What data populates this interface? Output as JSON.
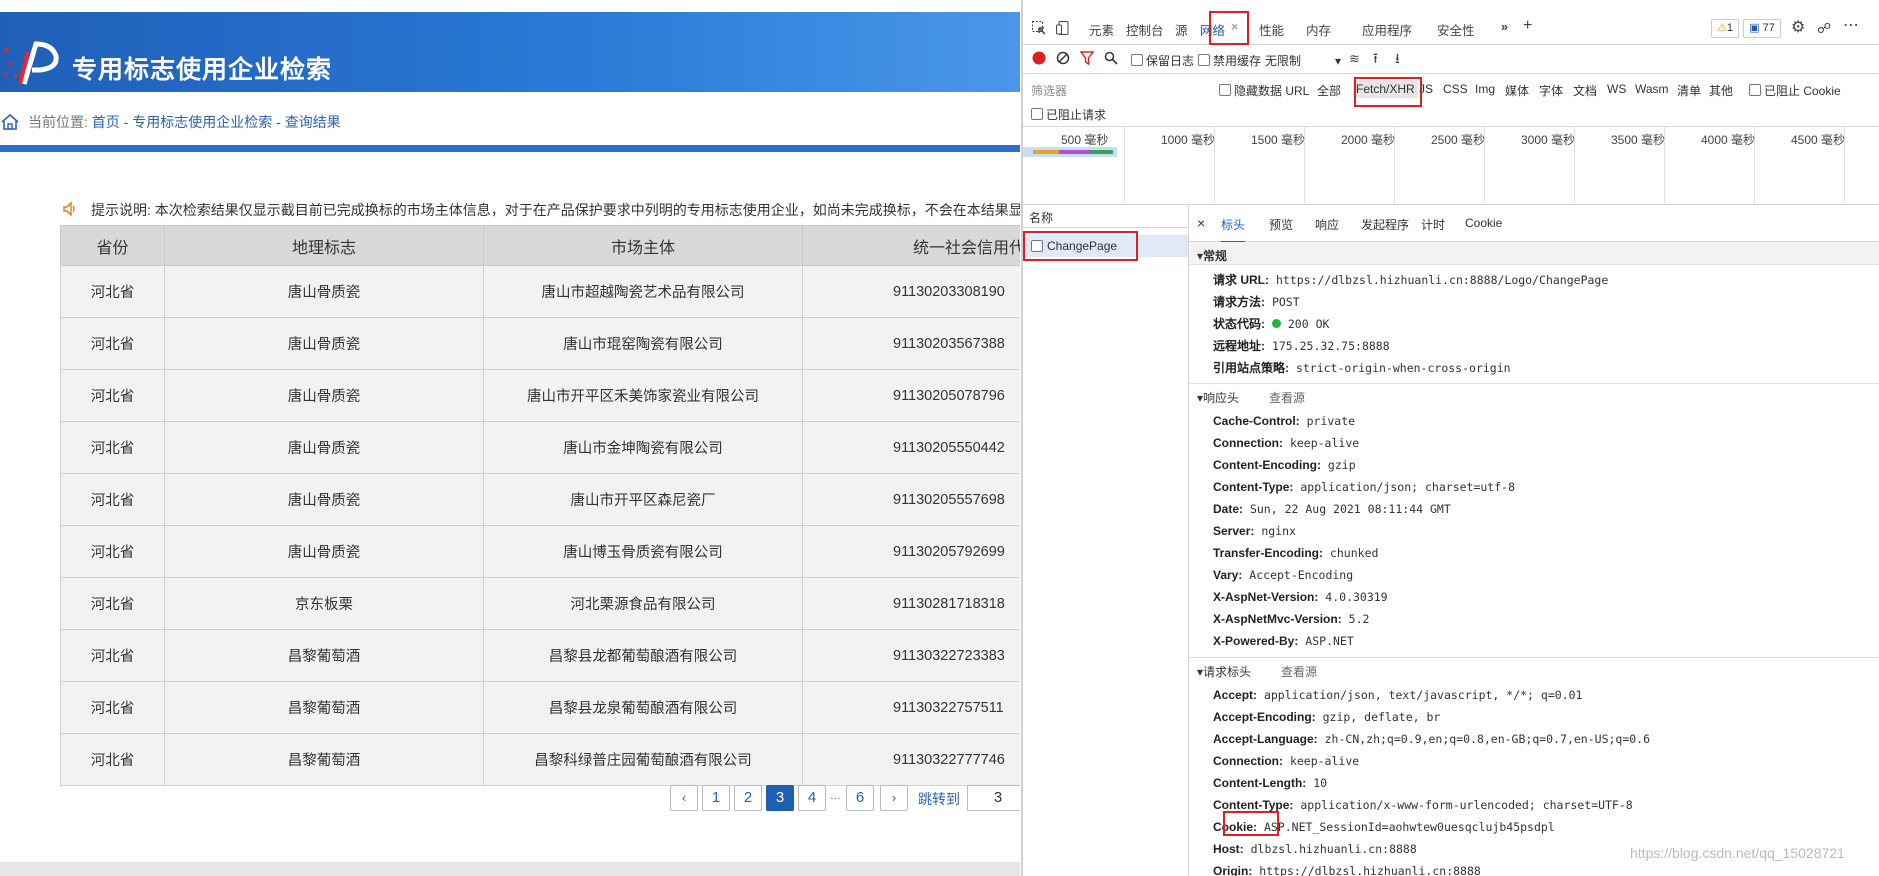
{
  "site": {
    "title": "专用标志使用企业检索",
    "breadcrumb": {
      "prefix": "当前位置:",
      "home": "首页",
      "sep1": "-",
      "section": "专用标志使用企业检索",
      "sep2": "-",
      "current": "查询结果"
    },
    "notice": "提示说明: 本次检索结果仅显示截目前已完成换标的市场主体信息，对于在产品保护要求中列明的专用标志使用企业，如尚未完成换标，不会在本结果显"
  },
  "table": {
    "headers": [
      "省份",
      "地理标志",
      "市场主体",
      "统一社会信用代"
    ],
    "rows": [
      [
        "河北省",
        "唐山骨质瓷",
        "唐山市超越陶瓷艺术品有限公司",
        "91130203308190"
      ],
      [
        "河北省",
        "唐山骨质瓷",
        "唐山市琨窑陶瓷有限公司",
        "91130203567388"
      ],
      [
        "河北省",
        "唐山骨质瓷",
        "唐山市开平区禾美饰家瓷业有限公司",
        "91130205078796"
      ],
      [
        "河北省",
        "唐山骨质瓷",
        "唐山市金坤陶瓷有限公司",
        "91130205550442"
      ],
      [
        "河北省",
        "唐山骨质瓷",
        "唐山市开平区森尼瓷厂",
        "91130205557698"
      ],
      [
        "河北省",
        "唐山骨质瓷",
        "唐山博玉骨质瓷有限公司",
        "91130205792699"
      ],
      [
        "河北省",
        "京东板栗",
        "河北栗源食品有限公司",
        "91130281718318"
      ],
      [
        "河北省",
        "昌黎葡萄酒",
        "昌黎县龙都葡萄酿酒有限公司",
        "91130322723383"
      ],
      [
        "河北省",
        "昌黎葡萄酒",
        "昌黎县龙泉葡萄酿酒有限公司",
        "91130322757511"
      ],
      [
        "河北省",
        "昌黎葡萄酒",
        "昌黎科绿普庄园葡萄酿酒有限公司",
        "91130322777746"
      ]
    ]
  },
  "pager": {
    "prev": "‹",
    "next": "›",
    "pages": [
      "1",
      "2",
      "3",
      "4",
      "6"
    ],
    "current": "3",
    "dots": "...",
    "jump_label": "跳转到",
    "jump_value": "3"
  },
  "devtools": {
    "tabs": [
      "元素",
      "控制台",
      "源",
      "网络",
      "性能",
      "内存",
      "应用程序",
      "安全性"
    ],
    "active_tab": "网络",
    "warn_count": "1",
    "msg_count": "77",
    "toolbar": {
      "preserve_log": "保留日志",
      "disable_cache": "禁用缓存",
      "throttle": "无限制"
    },
    "filter": {
      "placeholder": "筛选器",
      "hide_data_url": "隐藏数据 URL",
      "types": [
        "全部",
        "Fetch/XHR",
        "JS",
        "CSS",
        "Img",
        "媒体",
        "字体",
        "文档",
        "WS",
        "Wasm",
        "清单",
        "其他"
      ],
      "active_type": "Fetch/XHR",
      "blocked_cookie": "已阻止 Cookie",
      "blocked_requests": "已阻止请求"
    },
    "timeline_ticks": [
      "500 毫秒",
      "1000 毫秒",
      "1500 毫秒",
      "2000 毫秒",
      "2500 毫秒",
      "3000 毫秒",
      "3500 毫秒",
      "4000 毫秒",
      "4500 毫秒"
    ],
    "list_header": "名称",
    "request_name": "ChangePage",
    "detail_tabs": [
      "×",
      "标头",
      "预览",
      "响应",
      "发起程序",
      "计时",
      "Cookie"
    ],
    "active_detail_tab": "标头",
    "general": {
      "title": "常规",
      "rows": [
        {
          "k": "请求 URL:",
          "v": "https://dlbzsl.hizhuanli.cn:8888/Logo/ChangePage"
        },
        {
          "k": "请求方法:",
          "v": "POST"
        },
        {
          "k": "状态代码:",
          "v": "200 OK"
        },
        {
          "k": "远程地址:",
          "v": "175.25.32.75:8888"
        },
        {
          "k": "引用站点策略:",
          "v": "strict-origin-when-cross-origin"
        }
      ]
    },
    "response_headers": {
      "title": "响应头",
      "view_source": "查看源",
      "rows": [
        {
          "k": "Cache-Control:",
          "v": "private"
        },
        {
          "k": "Connection:",
          "v": "keep-alive"
        },
        {
          "k": "Content-Encoding:",
          "v": "gzip"
        },
        {
          "k": "Content-Type:",
          "v": "application/json; charset=utf-8"
        },
        {
          "k": "Date:",
          "v": "Sun, 22 Aug 2021 08:11:44 GMT"
        },
        {
          "k": "Server:",
          "v": "nginx"
        },
        {
          "k": "Transfer-Encoding:",
          "v": "chunked"
        },
        {
          "k": "Vary:",
          "v": "Accept-Encoding"
        },
        {
          "k": "X-AspNet-Version:",
          "v": "4.0.30319"
        },
        {
          "k": "X-AspNetMvc-Version:",
          "v": "5.2"
        },
        {
          "k": "X-Powered-By:",
          "v": "ASP.NET"
        }
      ]
    },
    "request_headers": {
      "title": "请求标头",
      "view_source": "查看源",
      "rows": [
        {
          "k": "Accept:",
          "v": "application/json, text/javascript, */*; q=0.01"
        },
        {
          "k": "Accept-Encoding:",
          "v": "gzip, deflate, br"
        },
        {
          "k": "Accept-Language:",
          "v": "zh-CN,zh;q=0.9,en;q=0.8,en-GB;q=0.7,en-US;q=0.6"
        },
        {
          "k": "Connection:",
          "v": "keep-alive"
        },
        {
          "k": "Content-Length:",
          "v": "10"
        },
        {
          "k": "Content-Type:",
          "v": "application/x-www-form-urlencoded; charset=UTF-8"
        },
        {
          "k": "Cookie:",
          "v": "ASP.NET_SessionId=aohwtew0uesqclujb45psdpl"
        },
        {
          "k": "Host:",
          "v": "dlbzsl.hizhuanli.cn:8888"
        },
        {
          "k": "Origin:",
          "v": "https://dlbzsl.hizhuanli.cn:8888"
        }
      ]
    }
  },
  "watermark": "https://blog.csdn.net/qq_15028721",
  "colors": {
    "highlight": "#e0201e",
    "banner": "#2a78d6",
    "pager_active": "#1f5fb0",
    "status_ok": "#1db53f"
  }
}
